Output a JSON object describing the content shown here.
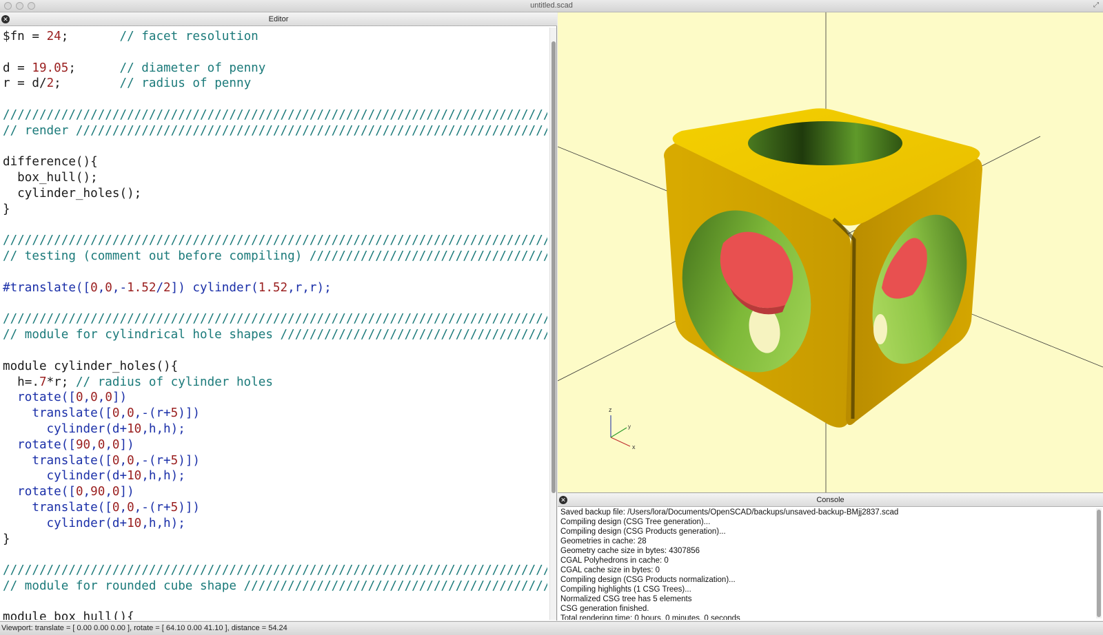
{
  "window": {
    "title": "untitled.scad"
  },
  "editor": {
    "header": "Editor",
    "lines": [
      [
        {
          "t": "$fn = ",
          "c": "kw"
        },
        {
          "t": "24",
          "c": "num"
        },
        {
          "t": ";       ",
          "c": "kw"
        },
        {
          "t": "// facet resolution",
          "c": "comment"
        }
      ],
      [],
      [
        {
          "t": "d = ",
          "c": "kw"
        },
        {
          "t": "19.05",
          "c": "num"
        },
        {
          "t": ";      ",
          "c": "kw"
        },
        {
          "t": "// diameter of penny",
          "c": "comment"
        }
      ],
      [
        {
          "t": "r = d/",
          "c": "kw"
        },
        {
          "t": "2",
          "c": "num"
        },
        {
          "t": ";        ",
          "c": "kw"
        },
        {
          "t": "// radius of penny",
          "c": "comment"
        }
      ],
      [],
      [
        {
          "t": "////////////////////////////////////////////////////////////////////////////",
          "c": "comment"
        }
      ],
      [
        {
          "t": "// render ///////////////////////////////////////////////////////////////////",
          "c": "comment"
        }
      ],
      [],
      [
        {
          "t": "difference(){",
          "c": "kw"
        }
      ],
      [
        {
          "t": "  box_hull();",
          "c": "kw"
        }
      ],
      [
        {
          "t": "  cylinder_holes();",
          "c": "kw"
        }
      ],
      [
        {
          "t": "}",
          "c": "kw"
        }
      ],
      [],
      [
        {
          "t": "////////////////////////////////////////////////////////////////////////////",
          "c": "comment"
        }
      ],
      [
        {
          "t": "// testing (comment out before compiling) ///////////////////////////////////",
          "c": "comment"
        }
      ],
      [],
      [
        {
          "t": "#translate([",
          "c": "builtin"
        },
        {
          "t": "0",
          "c": "num"
        },
        {
          "t": ",",
          "c": "builtin"
        },
        {
          "t": "0",
          "c": "num"
        },
        {
          "t": ",-",
          "c": "builtin"
        },
        {
          "t": "1.52",
          "c": "num"
        },
        {
          "t": "/",
          "c": "builtin"
        },
        {
          "t": "2",
          "c": "num"
        },
        {
          "t": "]) cylinder(",
          "c": "builtin"
        },
        {
          "t": "1.52",
          "c": "num"
        },
        {
          "t": ",r,r);",
          "c": "builtin"
        }
      ],
      [],
      [
        {
          "t": "////////////////////////////////////////////////////////////////////////////",
          "c": "comment"
        }
      ],
      [
        {
          "t": "// module for cylindrical hole shapes ///////////////////////////////////////",
          "c": "comment"
        }
      ],
      [],
      [
        {
          "t": "module cylinder_holes(){",
          "c": "kw"
        }
      ],
      [
        {
          "t": "  h=.",
          "c": "kw"
        },
        {
          "t": "7",
          "c": "num"
        },
        {
          "t": "*r; ",
          "c": "kw"
        },
        {
          "t": "// radius of cylinder holes",
          "c": "comment"
        }
      ],
      [
        {
          "t": "  rotate([",
          "c": "builtin"
        },
        {
          "t": "0",
          "c": "num"
        },
        {
          "t": ",",
          "c": "builtin"
        },
        {
          "t": "0",
          "c": "num"
        },
        {
          "t": ",",
          "c": "builtin"
        },
        {
          "t": "0",
          "c": "num"
        },
        {
          "t": "])",
          "c": "builtin"
        }
      ],
      [
        {
          "t": "    translate([",
          "c": "builtin"
        },
        {
          "t": "0",
          "c": "num"
        },
        {
          "t": ",",
          "c": "builtin"
        },
        {
          "t": "0",
          "c": "num"
        },
        {
          "t": ",-(r+",
          "c": "builtin"
        },
        {
          "t": "5",
          "c": "num"
        },
        {
          "t": ")])",
          "c": "builtin"
        }
      ],
      [
        {
          "t": "      cylinder(d+",
          "c": "builtin"
        },
        {
          "t": "10",
          "c": "num"
        },
        {
          "t": ",h,h);",
          "c": "builtin"
        }
      ],
      [
        {
          "t": "  rotate([",
          "c": "builtin"
        },
        {
          "t": "90",
          "c": "num"
        },
        {
          "t": ",",
          "c": "builtin"
        },
        {
          "t": "0",
          "c": "num"
        },
        {
          "t": ",",
          "c": "builtin"
        },
        {
          "t": "0",
          "c": "num"
        },
        {
          "t": "])",
          "c": "builtin"
        }
      ],
      [
        {
          "t": "    translate([",
          "c": "builtin"
        },
        {
          "t": "0",
          "c": "num"
        },
        {
          "t": ",",
          "c": "builtin"
        },
        {
          "t": "0",
          "c": "num"
        },
        {
          "t": ",-(r+",
          "c": "builtin"
        },
        {
          "t": "5",
          "c": "num"
        },
        {
          "t": ")])",
          "c": "builtin"
        }
      ],
      [
        {
          "t": "      cylinder(d+",
          "c": "builtin"
        },
        {
          "t": "10",
          "c": "num"
        },
        {
          "t": ",h,h);",
          "c": "builtin"
        }
      ],
      [
        {
          "t": "  rotate([",
          "c": "builtin"
        },
        {
          "t": "0",
          "c": "num"
        },
        {
          "t": ",",
          "c": "builtin"
        },
        {
          "t": "90",
          "c": "num"
        },
        {
          "t": ",",
          "c": "builtin"
        },
        {
          "t": "0",
          "c": "num"
        },
        {
          "t": "])",
          "c": "builtin"
        }
      ],
      [
        {
          "t": "    translate([",
          "c": "builtin"
        },
        {
          "t": "0",
          "c": "num"
        },
        {
          "t": ",",
          "c": "builtin"
        },
        {
          "t": "0",
          "c": "num"
        },
        {
          "t": ",-(r+",
          "c": "builtin"
        },
        {
          "t": "5",
          "c": "num"
        },
        {
          "t": ")])",
          "c": "builtin"
        }
      ],
      [
        {
          "t": "      cylinder(d+",
          "c": "builtin"
        },
        {
          "t": "10",
          "c": "num"
        },
        {
          "t": ",h,h);",
          "c": "builtin"
        }
      ],
      [
        {
          "t": "}",
          "c": "kw"
        }
      ],
      [],
      [
        {
          "t": "////////////////////////////////////////////////////////////////////////////",
          "c": "comment"
        }
      ],
      [
        {
          "t": "// module for rounded cube shape ////////////////////////////////////////////",
          "c": "comment"
        }
      ],
      [],
      [
        {
          "t": "module box_hull(){",
          "c": "kw"
        }
      ]
    ]
  },
  "viewport": {
    "axis_labels": {
      "z": "z",
      "y": "y",
      "x": "x"
    },
    "colors": {
      "background": "#fdfbc7",
      "model": "#e3b500",
      "hole_interior": "#7db838",
      "penny": "#e85050"
    }
  },
  "console": {
    "header": "Console",
    "lines": [
      "Saved backup file: /Users/lora/Documents/OpenSCAD/backups/unsaved-backup-BMjj2837.scad",
      "Compiling design (CSG Tree generation)...",
      "Compiling design (CSG Products generation)...",
      "Geometries in cache: 28",
      "Geometry cache size in bytes: 4307856",
      "CGAL Polyhedrons in cache: 0",
      "CGAL cache size in bytes: 0",
      "Compiling design (CSG Products normalization)...",
      "Compiling highlights (1 CSG Trees)...",
      "Normalized CSG tree has 5 elements",
      "CSG generation finished.",
      "Total rendering time: 0 hours, 0 minutes, 0 seconds"
    ]
  },
  "statusbar": {
    "text": "Viewport: translate = [ 0.00 0.00 0.00 ], rotate = [ 64.10 0.00 41.10 ], distance = 54.24"
  }
}
